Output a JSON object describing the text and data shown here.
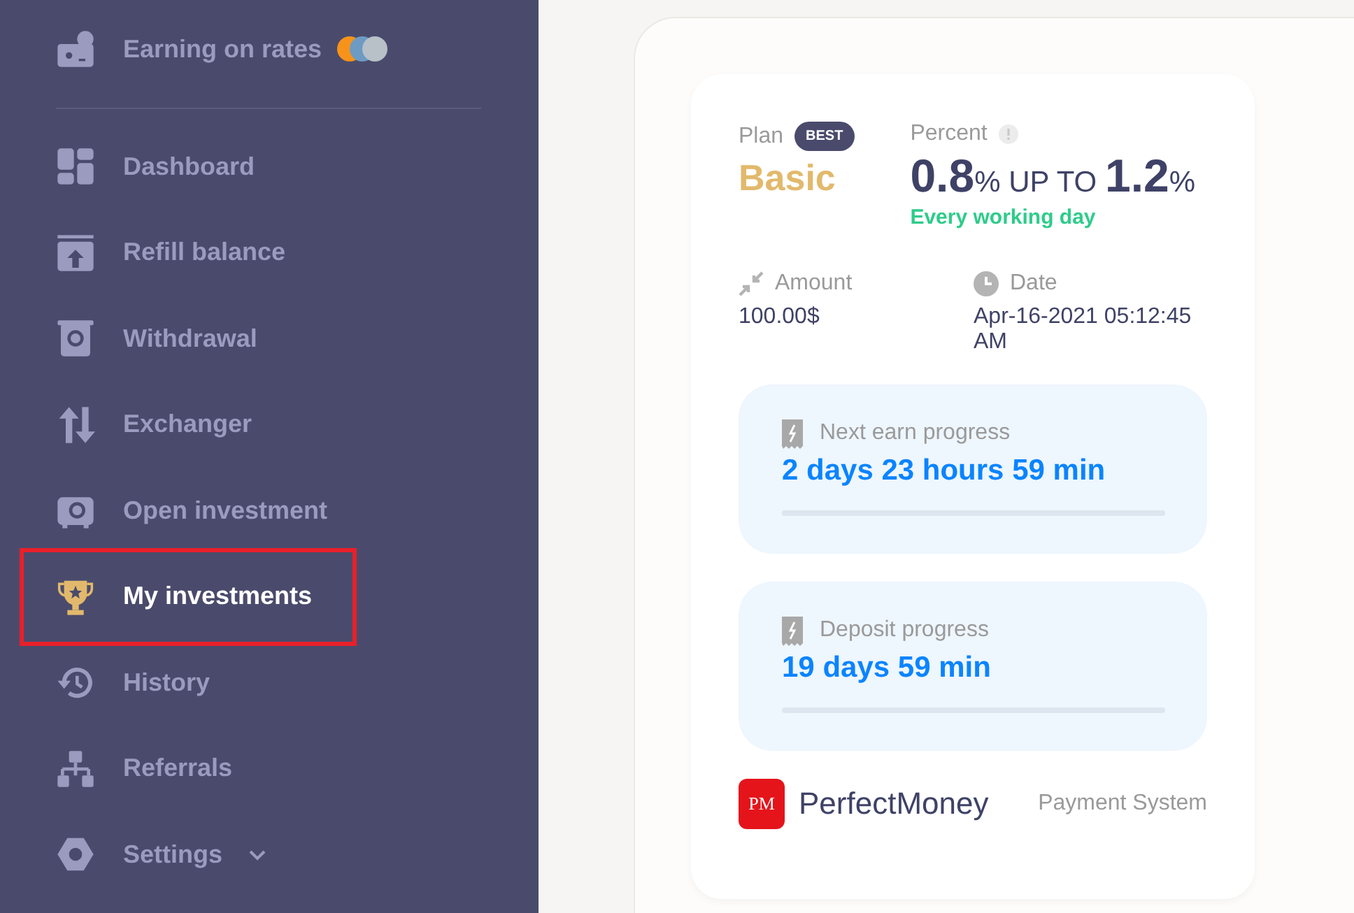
{
  "sidebar": {
    "items": [
      {
        "kind": "coins",
        "label": "Earning on rates",
        "selected": false,
        "highlighted": false
      },
      {
        "kind": "divider"
      },
      {
        "kind": "link",
        "label": "Dashboard",
        "selected": false,
        "highlighted": false
      },
      {
        "kind": "link",
        "label": "Refill balance",
        "selected": false,
        "highlighted": false
      },
      {
        "kind": "link",
        "label": "Withdrawal",
        "selected": false,
        "highlighted": false
      },
      {
        "kind": "link",
        "label": "Exchanger",
        "selected": false,
        "highlighted": false
      },
      {
        "kind": "link",
        "label": "Open investment",
        "selected": false,
        "highlighted": false
      },
      {
        "kind": "link",
        "label": "My investments",
        "selected": true,
        "highlighted": true
      },
      {
        "kind": "link",
        "label": "History",
        "selected": false,
        "highlighted": false
      },
      {
        "kind": "link",
        "label": "Referrals",
        "selected": false,
        "highlighted": false
      },
      {
        "kind": "dropdown",
        "label": "Settings",
        "selected": false,
        "highlighted": false,
        "expanded": false
      }
    ]
  },
  "investment": {
    "plan_label": "Plan",
    "badge": "BEST",
    "plan": "Basic",
    "percent_label": "Percent",
    "percent_from": "0.8",
    "percent_unit": "%",
    "up_to": "UP TO",
    "percent_to": "1.2",
    "frequency": "Every working day",
    "amount_label": "Amount",
    "amount": "100.00$",
    "date_label": "Date",
    "date": "Apr-16-2021 05:12:45 AM",
    "progress": [
      {
        "label": "Next earn progress",
        "value": "2 days 23 hours 59 min",
        "level": 0
      },
      {
        "label": "Deposit progress",
        "value": "19 days 59 min",
        "level": 0
      }
    ],
    "payment_name": "PerfectMoney",
    "payment_logo": "PM",
    "payment_label": "Payment System"
  }
}
